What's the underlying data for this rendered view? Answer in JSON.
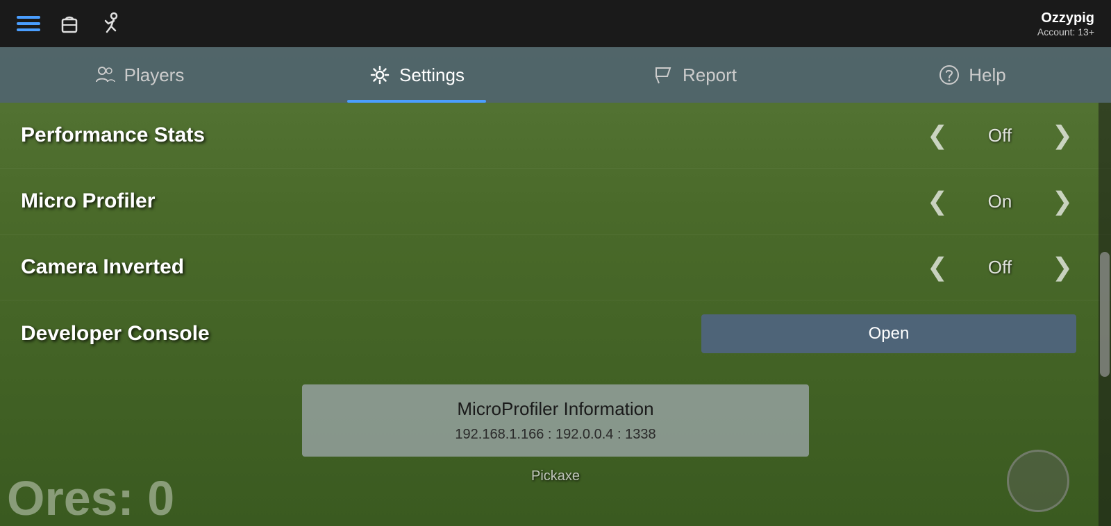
{
  "topBar": {
    "username": "Ozzypig",
    "accountInfo": "Account: 13+"
  },
  "tabs": [
    {
      "id": "players",
      "label": "Players",
      "active": false
    },
    {
      "id": "settings",
      "label": "Settings",
      "active": true
    },
    {
      "id": "report",
      "label": "Report",
      "active": false
    },
    {
      "id": "help",
      "label": "Help",
      "active": false
    }
  ],
  "settings": [
    {
      "id": "performance-stats",
      "label": "Performance Stats",
      "value": "Off"
    },
    {
      "id": "micro-profiler",
      "label": "Micro Profiler",
      "value": "On"
    },
    {
      "id": "camera-inverted",
      "label": "Camera Inverted",
      "value": "Off"
    },
    {
      "id": "developer-console",
      "label": "Developer Console",
      "value": null,
      "buttonLabel": "Open"
    }
  ],
  "microprofiler": {
    "title": "MicroProfiler Information",
    "ip": "192.168.1.166 : 192.0.0.4 : 1338"
  },
  "hud": {
    "pickaxeLabel": "Pickaxe",
    "oresLabel": "Ores: 0"
  },
  "arrows": {
    "left": "❮",
    "right": "❯"
  }
}
